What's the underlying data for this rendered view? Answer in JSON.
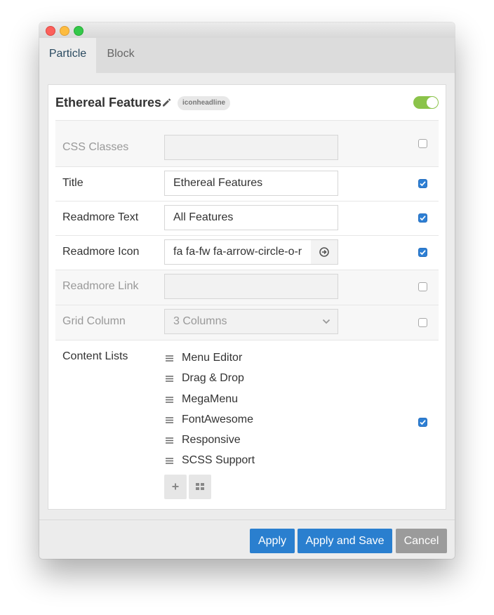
{
  "tabs": [
    {
      "label": "Particle",
      "active": true
    },
    {
      "label": "Block",
      "active": false
    }
  ],
  "panel": {
    "title": "Ethereal Features",
    "badge": "iconheadline",
    "enabled": true
  },
  "fields": {
    "css_classes": {
      "label": "CSS Classes",
      "value": "",
      "checked": false
    },
    "title": {
      "label": "Title",
      "value": "Ethereal Features",
      "checked": true
    },
    "readmore_text": {
      "label": "Readmore Text",
      "value": "All Features",
      "checked": true
    },
    "readmore_icon": {
      "label": "Readmore Icon",
      "value": "fa fa-fw fa-arrow-circle-o-r",
      "checked": true
    },
    "readmore_link": {
      "label": "Readmore Link",
      "value": "",
      "checked": false
    },
    "grid_column": {
      "label": "Grid Column",
      "value": "3 Columns",
      "checked": false
    },
    "content_lists": {
      "label": "Content Lists",
      "checked": true,
      "items": [
        "Menu Editor",
        "Drag & Drop",
        "MegaMenu",
        "FontAwesome",
        "Responsive",
        "SCSS Support"
      ]
    }
  },
  "footer": {
    "apply": "Apply",
    "apply_save": "Apply and Save",
    "cancel": "Cancel"
  },
  "colors": {
    "primary": "#2a7fcf",
    "toggle_on": "#8bc34a",
    "cancel": "#9b9b9b"
  }
}
